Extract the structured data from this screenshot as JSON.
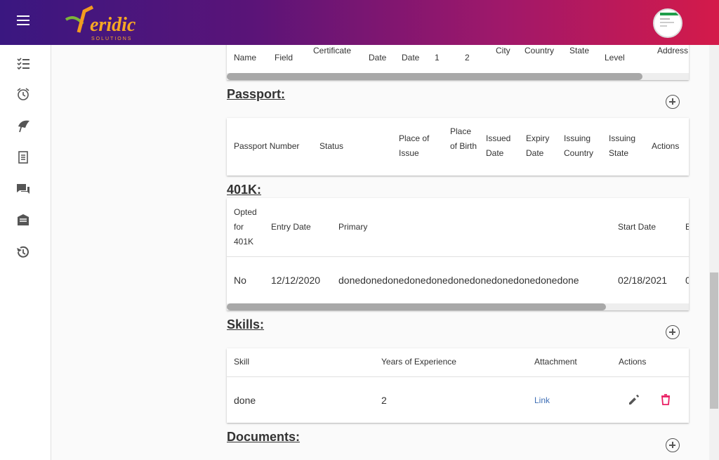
{
  "topbar": {
    "brand": "Veridic",
    "brand_sub": "SOLUTIONS"
  },
  "sidebar": {
    "icons": [
      "checklist-icon",
      "alarm-icon",
      "umbrella-icon",
      "document-icon",
      "chat-icon",
      "inbox-icon",
      "history-icon"
    ]
  },
  "education_table": {
    "headers": [
      "Name",
      "Field",
      "Certificate",
      "Date",
      "Date",
      "1",
      "2",
      "City",
      "Country",
      "State",
      "Level",
      "Address"
    ]
  },
  "passport": {
    "title": "Passport:",
    "headers": [
      "Passport Number",
      "Status",
      "Place of Issue",
      "Place of Birth",
      "Issued Date",
      "Expiry Date",
      "Issuing Country",
      "Issuing State",
      "Actions"
    ]
  },
  "k401": {
    "title": "401K:",
    "headers": [
      "Opted for 401K",
      "Entry Date",
      "Primary",
      "Start Date",
      "E"
    ],
    "row": {
      "opted": "No",
      "entry_date": "12/12/2020",
      "primary": "donedonedonedonedonedonedonedonedonedonedone",
      "start_date": "02/18/2021",
      "e": "0"
    }
  },
  "skills": {
    "title": "Skills:",
    "headers": [
      "Skill",
      "Years of Experience",
      "Attachment",
      "Actions"
    ],
    "row": {
      "skill": "done",
      "years": "2",
      "attachment": "Link"
    }
  },
  "documents": {
    "title": "Documents:"
  },
  "colors": {
    "accent_start": "#3a1780",
    "accent_end": "#d41a4a",
    "delete": "#e91e63",
    "link": "#3f6fb5"
  }
}
